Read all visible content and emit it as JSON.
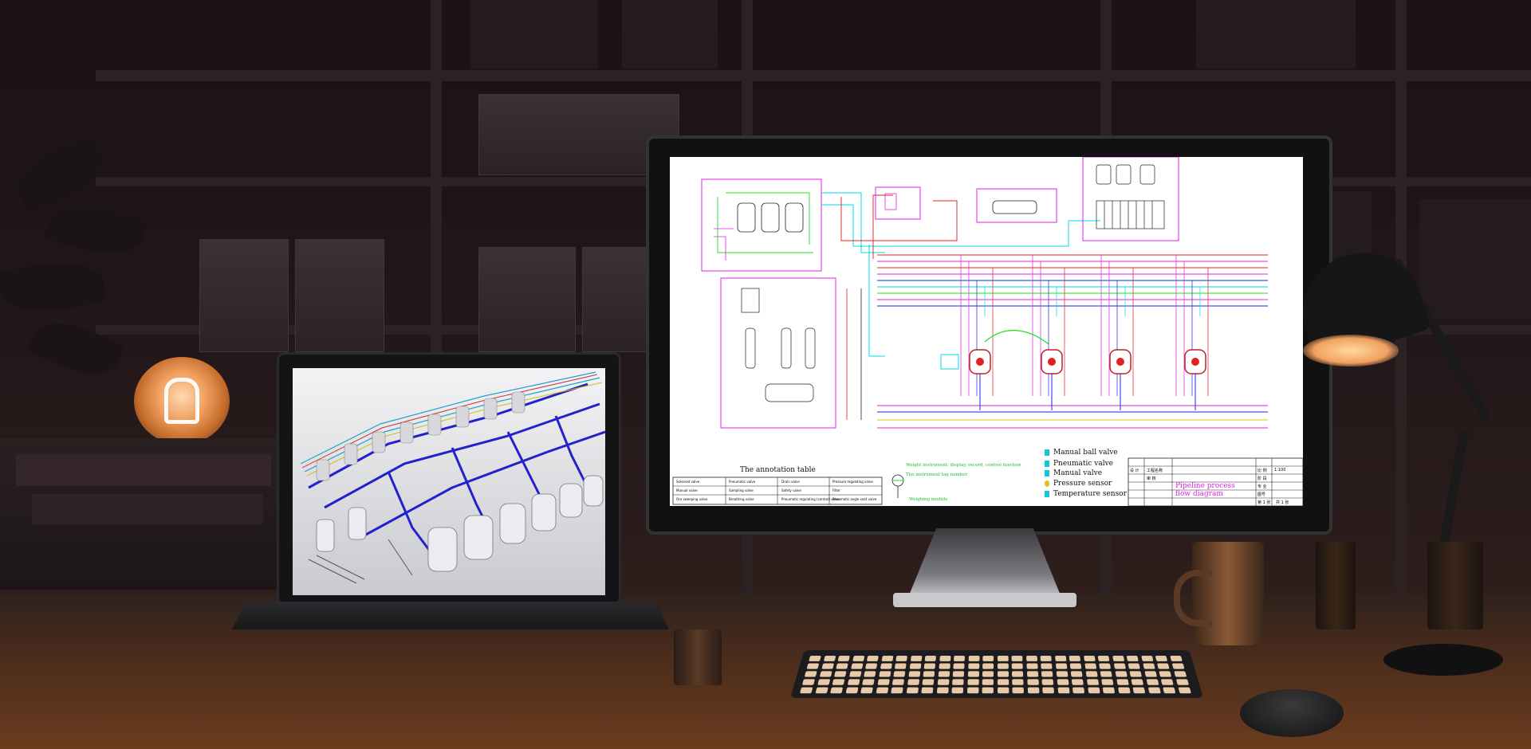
{
  "drawing": {
    "annotation_title": "The annotation table",
    "annotation_rows": [
      [
        "Solenoid valve",
        "Pneumatic valve",
        "Drain valve",
        "Pressure regulating valve"
      ],
      [
        "Manual valve",
        "Sampling valve",
        "Safety valve",
        "Filter"
      ],
      [
        "Ore sweeping valve",
        "Breathing valve",
        "Pneumatic regulating (control) valve",
        "Pneumatic angle seat valve"
      ]
    ],
    "notes": [
      "Weight instrument: display, record, control function",
      "The instrument tag number",
      "Weighing module"
    ],
    "legend": [
      {
        "label": "Manual ball valve",
        "icon": "manual-ball-valve-icon",
        "color": "#13c6d8"
      },
      {
        "label": "Pneumatic valve",
        "icon": "pneumatic-valve-icon",
        "color": "#13c6d8"
      },
      {
        "label": "Manual valve",
        "icon": "manual-valve-icon",
        "color": "#13c6d8"
      },
      {
        "label": "Pressure sensor",
        "icon": "pressure-sensor-icon",
        "color": "#d8c613"
      },
      {
        "label": "Temperature sensor",
        "icon": "temperature-sensor-icon",
        "color": "#13c6d8"
      }
    ],
    "title_block": {
      "title": "Pipeline process flow diagram",
      "scale": "1:100",
      "labels": [
        "设 计",
        "工程名称",
        "审 核",
        "比 例",
        "阶 段",
        "专 业",
        "图号",
        "第 1 张",
        "共 1 张"
      ]
    },
    "colors": {
      "magenta": "#e020e0",
      "cyan": "#00d8e8",
      "green": "#20e020",
      "red": "#e02020",
      "blue": "#2020e0"
    }
  }
}
